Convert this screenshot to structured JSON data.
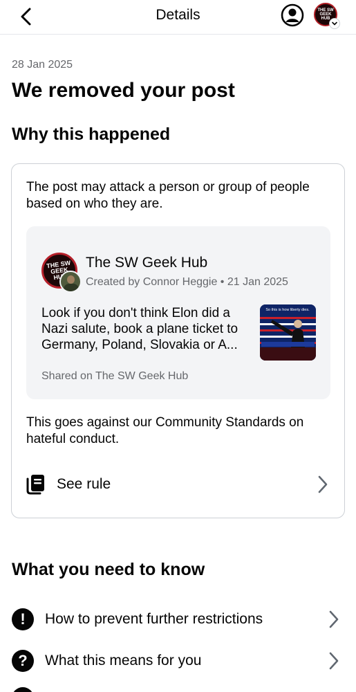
{
  "header": {
    "title": "Details",
    "back_icon": "chevron-left-icon",
    "account_icon": "account-circle-icon",
    "profile_logo_text": "THE SW GEEK HUB"
  },
  "main": {
    "date": "28 Jan 2025",
    "title": "We removed your post",
    "why_heading": "Why this happened",
    "reason": "The post may attack a person or group of people based on who they are.",
    "post": {
      "page_name": "The SW Geek Hub",
      "page_logo_text": "THE SW GEEK HUB",
      "creator_line": "Created by Connor Heggie • 21 Jan 2025",
      "text": "Look if you don't think Elon did a Nazi salute, book a plane ticket to Germany, Poland, Slovakia or A...",
      "thumbnail_caption": "So this is how liberty dies.",
      "shared_line": "Shared on The SW Geek Hub"
    },
    "standards_text": "This goes against our Community Standards on hateful conduct.",
    "see_rule_label": "See rule",
    "know_heading": "What you need to know",
    "info_items": [
      {
        "label": "How to prevent further restrictions",
        "icon": "exclamation-icon"
      },
      {
        "label": "What this means for you",
        "icon": "question-icon"
      }
    ]
  },
  "colors": {
    "text_primary": "#050505",
    "text_secondary": "#65676b",
    "card_border": "#ccd0d5",
    "preview_bg": "#f3f4f6",
    "brand_red": "#b5202a"
  }
}
